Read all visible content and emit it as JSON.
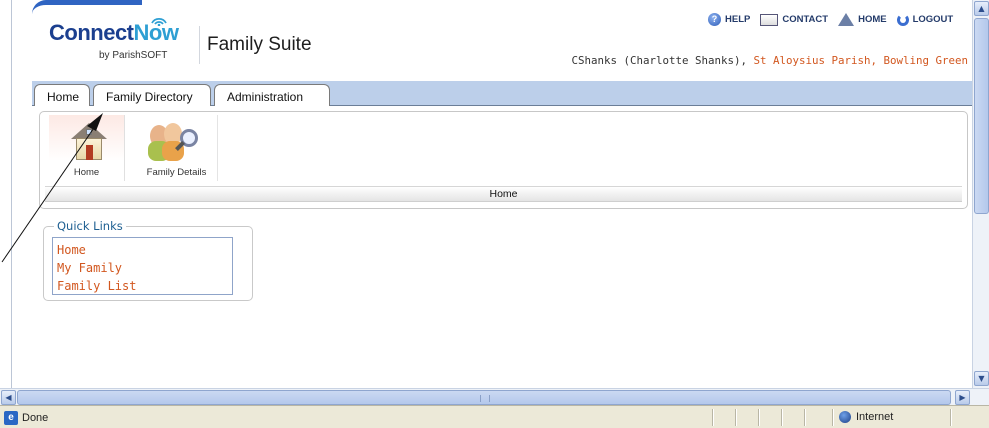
{
  "header": {
    "logo": {
      "brand_connect": "Connect",
      "brand_now": "Now",
      "tagline": "by ParishSOFT"
    },
    "suite_title": "Family Suite",
    "top_links": [
      {
        "label": "HELP",
        "icon": "help-icon"
      },
      {
        "label": "CONTACT",
        "icon": "contact-icon"
      },
      {
        "label": "HOME",
        "icon": "home-icon"
      },
      {
        "label": "LOGOUT",
        "icon": "logout-icon"
      }
    ],
    "user": "CShanks (Charlotte Shanks),",
    "parish": "St Aloysius Parish, Bowling Green"
  },
  "tabs": [
    {
      "label": "Home"
    },
    {
      "label": "Family Directory"
    },
    {
      "label": "Administration"
    }
  ],
  "toolbar": {
    "items": [
      {
        "label": "Home",
        "icon": "house-icon"
      },
      {
        "label": "Family Details",
        "icon": "family-search-icon"
      }
    ],
    "footer_label": "Home"
  },
  "quick_links": {
    "title": "Quick Links",
    "links": [
      {
        "label": "Home"
      },
      {
        "label": "My Family"
      },
      {
        "label": "Family List"
      }
    ]
  },
  "statusbar": {
    "status": "Done",
    "zone": "Internet"
  },
  "colors": {
    "link_orange": "#d2571f",
    "brand_blue": "#1b3f8f",
    "tabbar_blue": "#bccfea"
  }
}
